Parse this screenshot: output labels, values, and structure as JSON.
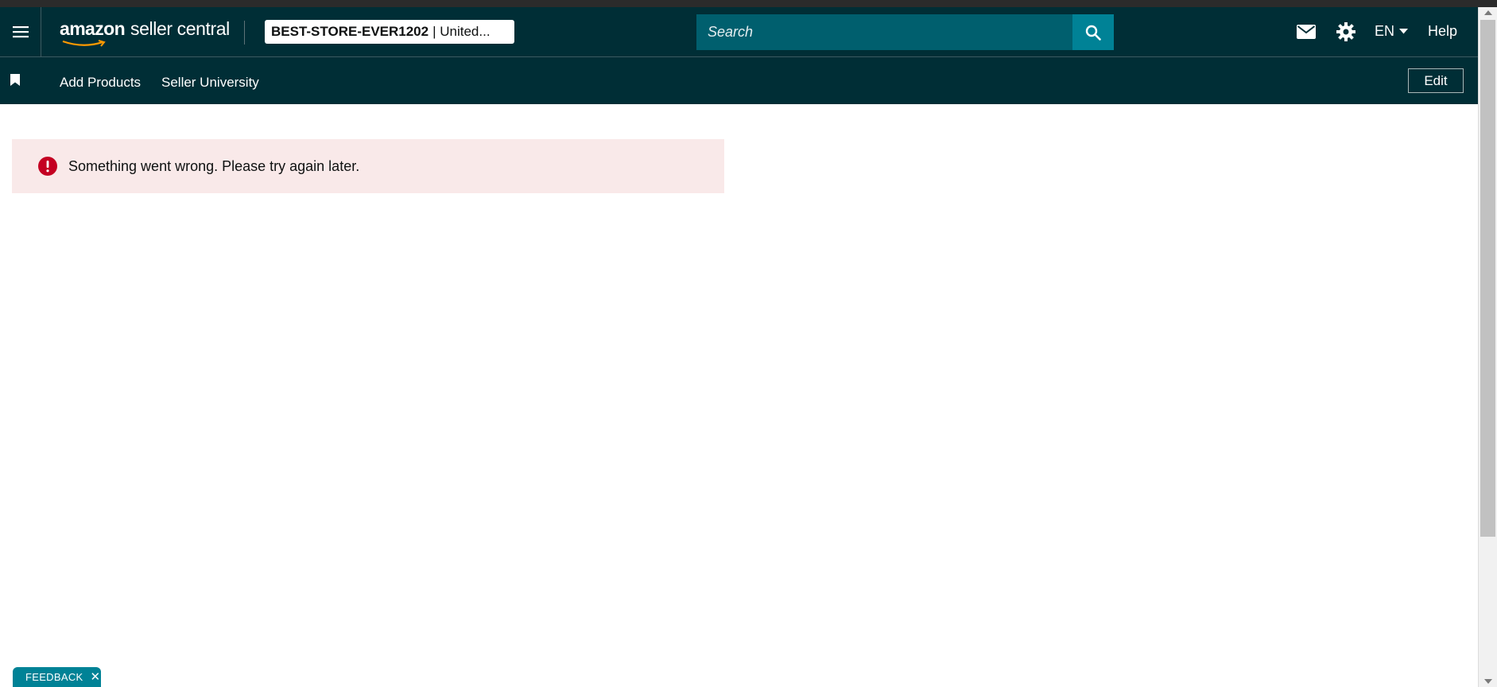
{
  "header": {
    "logo_brand": "amazon",
    "logo_product": "seller central",
    "store_name": "BEST-STORE-EVER1202",
    "store_region": "| United...",
    "search_placeholder": "Search",
    "language": "EN",
    "help_label": "Help",
    "icons": [
      "menu-icon",
      "search-icon",
      "mail-icon",
      "gear-icon",
      "caret-down-icon"
    ]
  },
  "nav": {
    "links": [
      "Add Products",
      "Seller University"
    ],
    "edit_label": "Edit",
    "icons": [
      "bookmark-icon"
    ]
  },
  "alert": {
    "message": "Something went wrong. Please try again later.",
    "icon": "error-icon",
    "color": "#c40022"
  },
  "feedback": {
    "label": "FEEDBACK",
    "close_glyph": "✕"
  },
  "colors": {
    "header_bg": "#002e36",
    "search_bg": "#005f6e",
    "accent": "#008296",
    "alert_bg": "#f9e9e9"
  }
}
